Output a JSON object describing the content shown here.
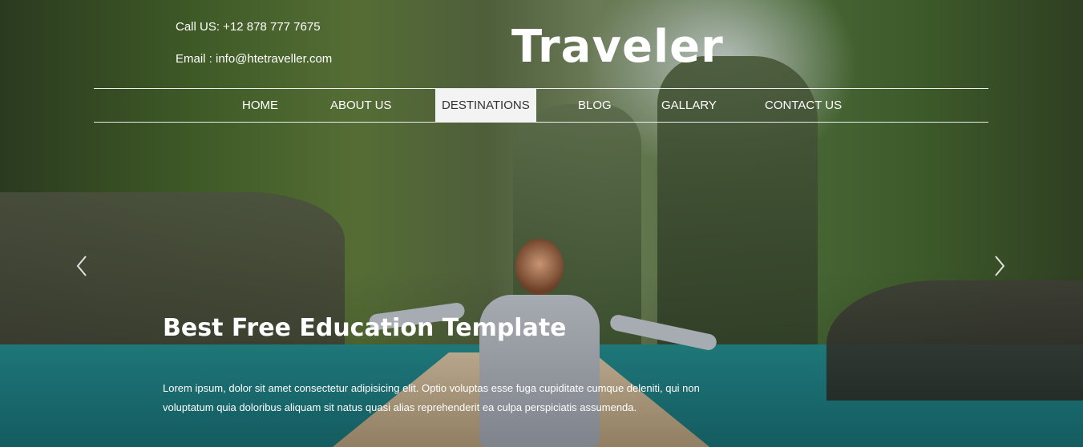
{
  "header": {
    "call": "Call US: +12 878 777 7675",
    "email": "Email : info@htetraveller.com",
    "brand": "Traveler"
  },
  "nav": {
    "items": [
      {
        "label": "HOME",
        "active": false
      },
      {
        "label": "ABOUT US",
        "active": false
      },
      {
        "label": "DESTINATIONS",
        "active": true
      },
      {
        "label": "BLOG",
        "active": false
      },
      {
        "label": "GALLARY",
        "active": false
      },
      {
        "label": "CONTACT US",
        "active": false
      }
    ]
  },
  "slider": {
    "title": "Best Free Education Template",
    "text": "Lorem ipsum, dolor sit amet consectetur adipisicing elit. Optio voluptas esse fuga cupiditate cumque deleniti, qui non voluptatum quia doloribus aliquam sit natus quasi alias reprehenderit ea culpa perspiciatis assumenda.",
    "prev_icon": "chevron-left-icon",
    "next_icon": "chevron-right-icon"
  },
  "colors": {
    "active_nav_bg": "#f3f3f3",
    "active_nav_text": "#333333",
    "text": "#ffffff"
  }
}
